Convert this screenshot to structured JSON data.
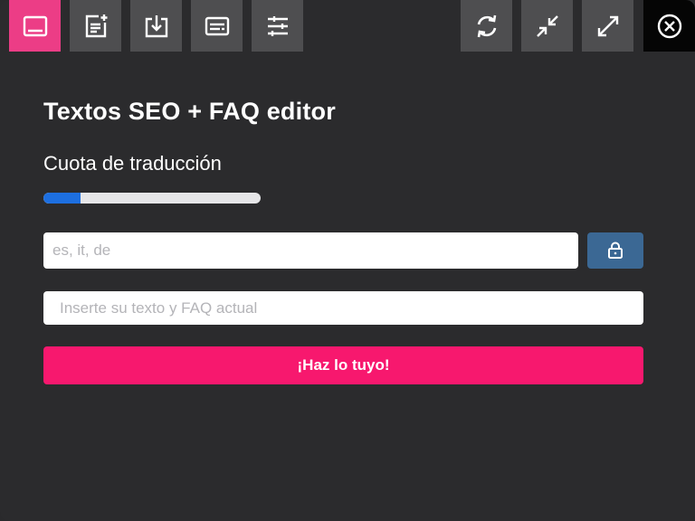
{
  "toolbar": {
    "left_buttons": [
      {
        "icon": "panel-icon",
        "active": true
      },
      {
        "icon": "note-add-icon",
        "active": false
      },
      {
        "icon": "download-icon",
        "active": false
      },
      {
        "icon": "subtitles-icon",
        "active": false
      },
      {
        "icon": "sliders-icon",
        "active": false
      }
    ],
    "right_buttons": [
      {
        "icon": "refresh-icon"
      },
      {
        "icon": "minimize-icon"
      },
      {
        "icon": "maximize-icon"
      },
      {
        "icon": "close-icon"
      }
    ]
  },
  "main": {
    "title": "Textos SEO + FAQ editor",
    "quota_label": "Cuota de traducción",
    "quota_progress": 0.17,
    "languages_placeholder": "es, it, de",
    "lock_icon": "lock-icon",
    "text_placeholder": "Inserte su texto y FAQ actual",
    "submit_label": "¡Haz lo tuyo!"
  },
  "colors": {
    "background": "#2b2b2d",
    "toolbar_button": "#4e4e50",
    "active_button": "#ec3d86",
    "close_button": "#050505",
    "progress_fill": "#1d6fe0",
    "lock_button": "#3b6894",
    "submit_button": "#f7186e"
  }
}
